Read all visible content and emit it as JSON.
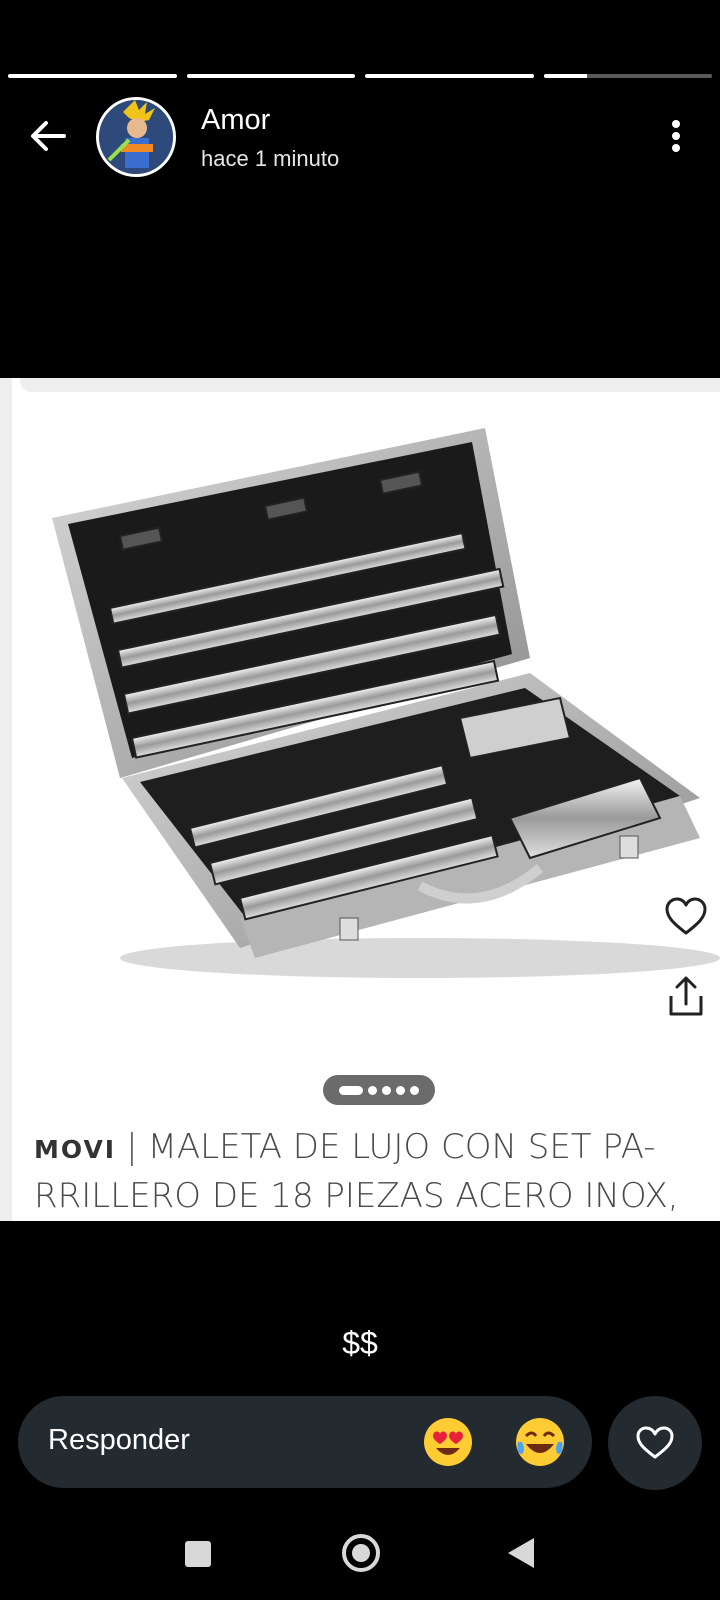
{
  "story": {
    "progress": [
      1.0,
      1.0,
      1.0,
      0.26
    ],
    "username": "Amor",
    "timestamp": "hace 1 minuto"
  },
  "post": {
    "brand": "MOVI",
    "separator": "|",
    "title": "MALETA DE LUJO CON SET PARRILLERO DE 18 PIEZAS ACERO INOX,",
    "title_line1": "MALETA DE LUJO CON SET PA-",
    "title_line2": "RRILLERO DE 18 PIEZAS ACERO INOX,",
    "carousel_count": 5,
    "carousel_active": 0
  },
  "caption": "$$",
  "reply": {
    "placeholder": "Responder",
    "quick_reactions": [
      "heart-eyes-emoji",
      "tears-of-joy-emoji"
    ]
  },
  "icons": {
    "back": "arrow-left-icon",
    "more": "more-vertical-icon",
    "save": "heart-outline-icon",
    "share": "share-icon",
    "like": "heart-outline-icon"
  },
  "nav": [
    "recent-apps-icon",
    "home-icon",
    "back-triangle-icon"
  ]
}
